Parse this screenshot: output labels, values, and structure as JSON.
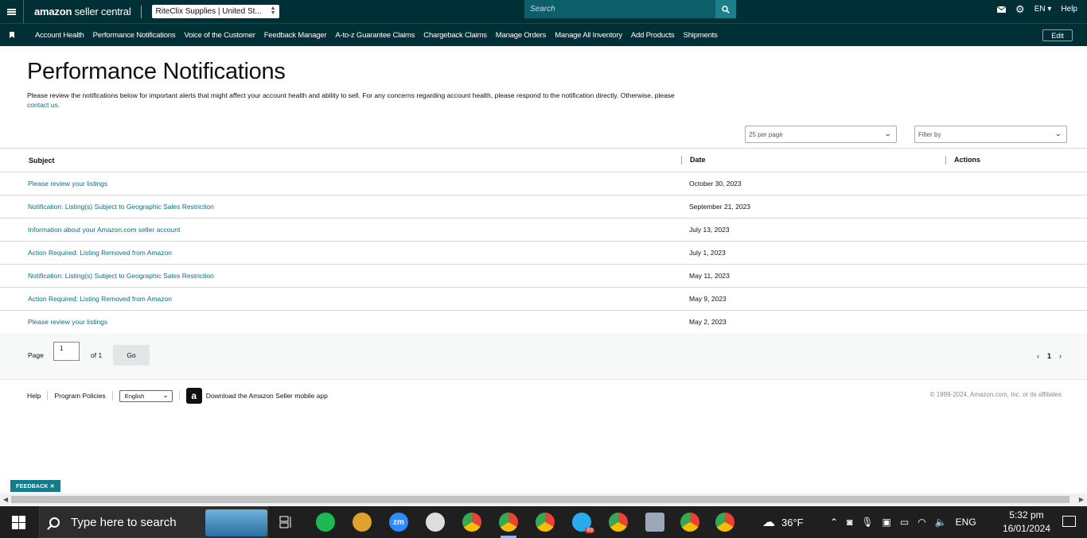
{
  "header": {
    "logo_brand": "amazon",
    "logo_product": "seller central",
    "store_selector": "RiteClix Supplies | United St...",
    "search_placeholder": "Search",
    "language": "EN",
    "help": "Help"
  },
  "nav": {
    "items": [
      "Account Health",
      "Performance Notifications",
      "Voice of the Customer",
      "Feedback Manager",
      "A-to-z Guarantee Claims",
      "Chargeback Claims",
      "Manage Orders",
      "Manage All Inventory",
      "Add Products",
      "Shipments"
    ],
    "edit": "Edit"
  },
  "main": {
    "title": "Performance Notifications",
    "description": "Please review the notifications below for important alerts that might affect your account health and ability to sell. For any concerns regarding account health, please respond to the notification directly. Otherwise, please",
    "contact_link": "contact us.",
    "per_page": "25 per page",
    "filter_placeholder": "Filter by"
  },
  "table": {
    "headers": {
      "subject": "Subject",
      "date": "Date",
      "actions": "Actions"
    },
    "rows": [
      {
        "subject": "Please review your listings",
        "date": "October 30, 2023"
      },
      {
        "subject": "Notification: Listing(s) Subject to Geographic Sales Restriction",
        "date": "September 21, 2023"
      },
      {
        "subject": "Information about your Amazon.com seller account",
        "date": "July 13, 2023"
      },
      {
        "subject": "Action Required: Listing Removed from Amazon",
        "date": "July 1, 2023"
      },
      {
        "subject": "Notification: Listing(s) Subject to Geographic Sales Restriction",
        "date": "May 11, 2023"
      },
      {
        "subject": "Action Required: Listing Removed from Amazon",
        "date": "May 9, 2023"
      },
      {
        "subject": "Please review your listings",
        "date": "May 2, 2023"
      }
    ]
  },
  "pager": {
    "page_label": "Page",
    "page_value": "1",
    "of_label": "of 1",
    "go": "Go",
    "prev": "‹",
    "current": "1",
    "next": "›"
  },
  "footer": {
    "help": "Help",
    "policies": "Program Policies",
    "language": "English",
    "app_link": "Download the Amazon Seller mobile app",
    "copyright": "© 1999-2024, Amazon.com, Inc. or its affiliates"
  },
  "feedback": "FEEDBACK ✕",
  "taskbar": {
    "search_text": "Type here to search",
    "telegram_badge": "49",
    "weather": "36°F",
    "lang": "ENG",
    "time": "5:32 pm",
    "date": "16/01/2024"
  },
  "colors": {
    "header_bg": "#002f36",
    "link": "#0b6f82",
    "search_bg": "#0b5f6b",
    "feedback_bg": "#137c8b"
  }
}
